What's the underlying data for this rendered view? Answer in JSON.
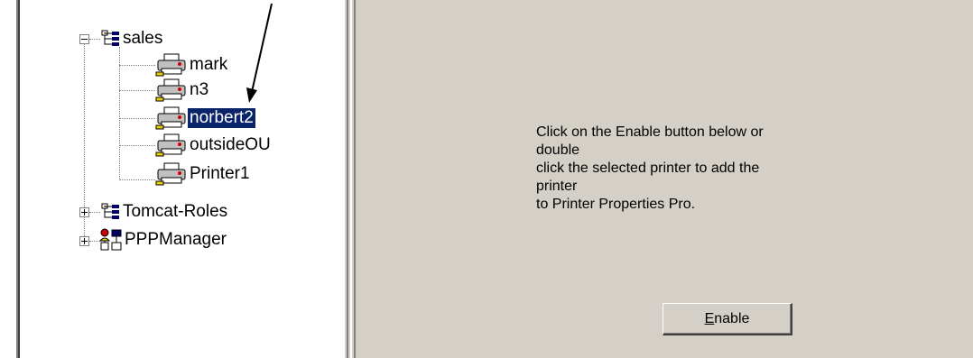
{
  "tree": {
    "nodes": [
      {
        "label": "sales",
        "icon": "group-icon",
        "expander": "minus"
      },
      {
        "label": "mark",
        "icon": "printer-icon"
      },
      {
        "label": "n3",
        "icon": "printer-icon"
      },
      {
        "label": "norbert2",
        "icon": "printer-icon",
        "selected": true
      },
      {
        "label": "outsideOU",
        "icon": "printer-icon"
      },
      {
        "label": "Printer1",
        "icon": "printer-icon"
      },
      {
        "label": "Tomcat-Roles",
        "icon": "group-icon",
        "expander": "plus"
      },
      {
        "label": "PPPManager",
        "icon": "users-icon",
        "expander": "plus"
      }
    ]
  },
  "panel": {
    "message": "Click on the Enable button below or double\nclick the selected printer to add the printer\nto Printer Properties Pro.",
    "enable_mnemonic": "E",
    "enable_rest": "nable"
  },
  "colors": {
    "selection": "#0a246a",
    "panel_bg": "#d4d0c8"
  }
}
